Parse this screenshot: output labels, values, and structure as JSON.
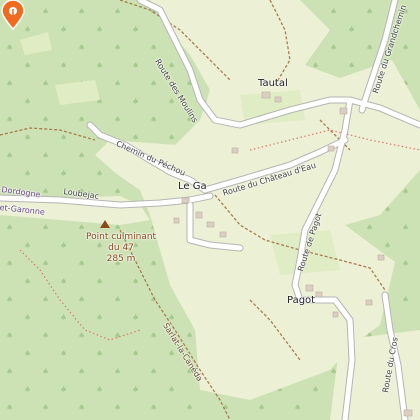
{
  "map": {
    "places": {
      "tautal": "Tautal",
      "le_gaudi": "Le Ga",
      "pagot": "Pagot"
    },
    "roads": {
      "route_des_moulins": "Route des Moulins",
      "route_du_grandchemin": "Route du Grandchemin",
      "chemin_du_pechou": "Chemin du Péchou",
      "route_du_chateau_deau": "Route du Château d'Eau",
      "route_de_pagot": "Route de Pagot",
      "route_du_cros": "Route du Cros",
      "loubejac": "Loubejac"
    },
    "areas": {
      "dordogne": "Dordogne",
      "garonne": "et-Garonne"
    },
    "trail": "Sarlat-la-Canéda",
    "peak": {
      "name_line1": "Point culminant",
      "name_line2": "du 47",
      "elevation": "285 m"
    },
    "marker_icon": "map-pin-icon",
    "colors": {
      "forest": "#cde2b4",
      "meadow": "#ecf0d4",
      "pin": "#f06a20"
    }
  }
}
